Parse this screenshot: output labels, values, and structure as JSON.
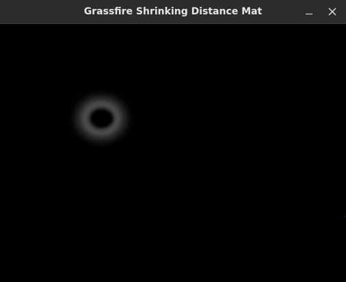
{
  "window": {
    "title": "Grassfire Shrinking Distance Mat",
    "titlebar_color": "#2c2c2c",
    "title_color": "#e6e6e6",
    "buttons": {
      "minimize_icon": "minimize-icon",
      "close_icon": "close-icon"
    }
  },
  "canvas": {
    "background": "#000000",
    "blob_color": "#5a5a5a"
  }
}
